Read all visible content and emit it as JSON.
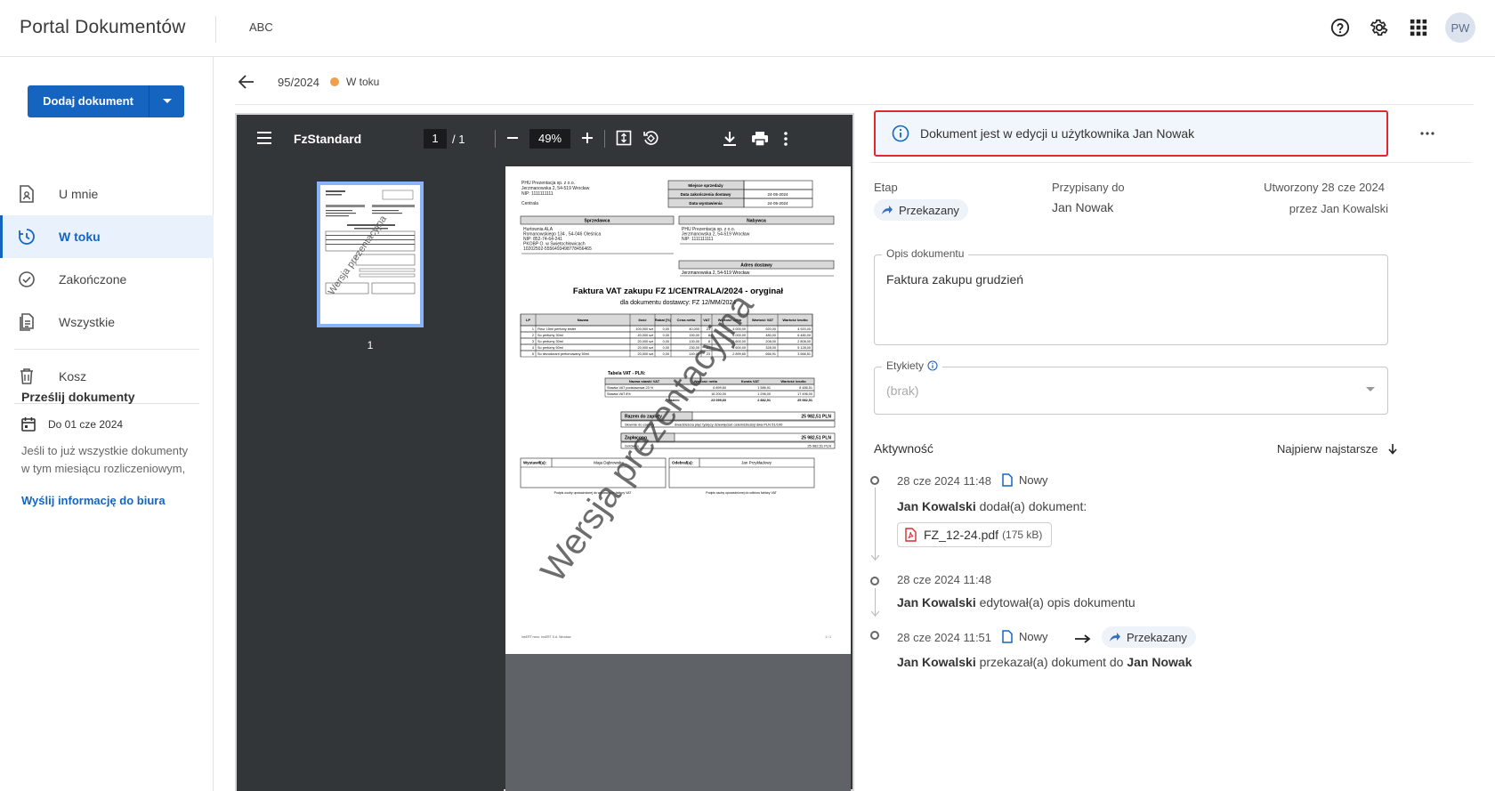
{
  "app": {
    "title": "Portal Dokumentów",
    "org": "ABC",
    "avatar": "PW"
  },
  "sidebar": {
    "add_button": "Dodaj dokument",
    "items": [
      {
        "label": "U mnie",
        "icon": "document-user-icon"
      },
      {
        "label": "W toku",
        "icon": "clock-icon"
      },
      {
        "label": "Zakończone",
        "icon": "check-circle-icon"
      },
      {
        "label": "Wszystkie",
        "icon": "documents-icon"
      },
      {
        "label": "Kosz",
        "icon": "trash-icon"
      }
    ],
    "upload": {
      "title": "Prześlij dokumenty",
      "date": "Do 01 cze 2024",
      "text": "Jeśli to już wszystkie dokumenty w tym miesiącu rozliczeniowym,",
      "link": "Wyślij informację do biura"
    }
  },
  "breadcrumb": {
    "number": "95/2024",
    "status": "W toku"
  },
  "viewer": {
    "name": "FzStandard",
    "page": "1",
    "total": "/  1",
    "zoom": "49%",
    "thumb_num": "1"
  },
  "doc": {
    "seller_name": "PHU Prezentacja sp. z o.o.",
    "seller_addr": "Jerzmanowska 2, 54-519 Wrocław",
    "seller_nip": "NIP: 1111111111",
    "centrala": "Centrala",
    "meta_rows": [
      [
        "Miejsce sprzedaży",
        ""
      ],
      [
        "Data zakończenia dostawy",
        "24-05-2024"
      ],
      [
        "Data wystawienia",
        "24-05-2024"
      ]
    ],
    "sprzedawca": "Sprzedawca",
    "nabywca": "Nabywca",
    "sprzed_lines": [
      "Hurtownia ALA",
      "Romanowskiego 134 , 54-046 Oleśnica",
      "NIP: 852-74-64-241",
      "PKOBP O. w Świętochłowicach",
      "10202502-5556493498778456465"
    ],
    "nabywca_lines": [
      "PHU Prezentacja sp. z o.o.",
      "Jerzmanowska 2, 54-519 Wrocław",
      "NIP: 1111111111"
    ],
    "adres": "Adres dostawy",
    "adres_line": "Jerzmanowska 2, 54-519 Wrocław",
    "title": "Faktura VAT zakupu FZ 1/CENTRALA/2024 - oryginał",
    "subtitle": "dla dokumentu dostawcy: FZ 12/MM/2024",
    "table_headers": [
      "LP",
      "Nazwa",
      "Ilość",
      "Rabat [%]",
      "Cena netto",
      "VAT",
      "Wartość netto",
      "Wartość VAT",
      "Wartość brutto"
    ],
    "table_rows": [
      [
        "1",
        "Fleur 15ml perfumy testet",
        "100,000 szt",
        "0,00",
        "40,000",
        "23",
        "4 000,00",
        "920,00",
        "4 920,00"
      ],
      [
        "2",
        "So perfumy 30ml",
        "40,000 szt",
        "0,00",
        "150,00",
        "8",
        "6 000,00",
        "480,00",
        "6 480,00"
      ],
      [
        "3",
        "So perfumy 30ml",
        "20,000 szt",
        "0,00",
        "130,00",
        "8",
        "2 600,00",
        "208,00",
        "2 808,00"
      ],
      [
        "4",
        "So perfumy 50ml",
        "20,000 szt",
        "0,00",
        "230,00",
        "23",
        "4 600,00",
        "328,00",
        "5 128,00"
      ],
      [
        "5",
        "So dezodorant perfumowany 50ml",
        "20,000 szt",
        "0,00",
        "140,00",
        "23",
        "2 899,60",
        "666,91",
        "3 566,51"
      ]
    ],
    "vat_title": "Tabela VAT - PLN:",
    "vat_headers": [
      "Nazwa stawki VAT",
      "Wartość netto",
      "Kwota VAT",
      "Wartość brutto"
    ],
    "vat_rows": [
      [
        "Stawka VAT podstawowa 23 %",
        "6 899,60",
        "1 586,91",
        "8 486,51"
      ],
      [
        "Stawka VAT 8%",
        "16 200,00",
        "1 296,00",
        "17 496,00"
      ],
      [
        "Razem:",
        "23 099,60",
        "2 882,91",
        "25 982,51"
      ]
    ],
    "razem_label": "Razem do zapłaty",
    "razem_val": "25 982,51 PLN",
    "slownie_label": "Słownie do zapłaty",
    "slownie_val": "dwadzieścia pięć tysięcy dziewięćset osiemdziesiąt dwa PLN 51/100",
    "zaplacono_label": "Zapłacono",
    "zaplacono_val": "25 982,51 PLN",
    "gotowka": "Gotówka",
    "gotowka_val": "25 982,51 PLN",
    "wystawil_label": "Wystawił(a):",
    "wystawil_name": "Maja Dąbrowska",
    "odebral_label": "Odebrał(a):",
    "odebral_name": "Jan Przykładowy",
    "sig_left": "Podpis osoby upoważnionej do wystawienia faktury VAT",
    "sig_right": "Podpis osoby upoważnionej do odbioru faktury VAT",
    "footer_left": "InsERT nexo: InsERT S.A. Wrocław",
    "footer_right": "1 / 1",
    "watermark": "Wersja prezentacyjna"
  },
  "details": {
    "alert": "Dokument jest w edycji u użytkownika Jan Nowak",
    "etap_label": "Etap",
    "etap_value": "Przekazany",
    "assigned_label": "Przypisany do",
    "assigned_value": "Jan Nowak",
    "created_label": "Utworzony 28 cze 2024",
    "created_by": "przez Jan Kowalski",
    "opis_label": "Opis dokumentu",
    "opis_value": "Faktura zakupu grudzień",
    "etykiety_label": "Etykiety",
    "etykiety_placeholder": "(brak)",
    "activity_title": "Aktywność",
    "sort_label": "Najpierw najstarsze",
    "events": [
      {
        "time": "28 cze 2024 11:48",
        "tag": "Nowy",
        "actor": "Jan Kowalski",
        "text": "dodał(a) dokument:",
        "file": "FZ_12-24.pdf",
        "size": "(175 kB)"
      },
      {
        "time": "28 cze 2024 11:48",
        "actor": "Jan Kowalski",
        "text": "edytował(a) opis dokumentu"
      },
      {
        "time": "28 cze 2024 11:51",
        "tag": "Nowy",
        "tag2": "Przekazany",
        "actor": "Jan Kowalski",
        "text": "przekazał(a) dokument do",
        "target": "Jan Nowak"
      }
    ]
  },
  "colors": {
    "accent": "#1565c0",
    "status_dot": "#f0a04b",
    "alert_border": "#e0282d",
    "pdf_red": "#d32f2f"
  }
}
